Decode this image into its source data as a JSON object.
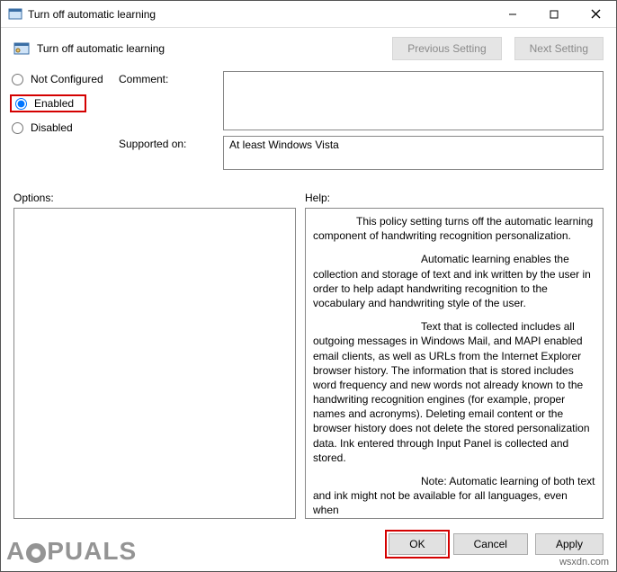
{
  "window": {
    "title": "Turn off automatic learning"
  },
  "header": {
    "name": "Turn off automatic learning",
    "prev": "Previous Setting",
    "next": "Next Setting"
  },
  "state": {
    "not_configured": "Not Configured",
    "enabled": "Enabled",
    "disabled": "Disabled",
    "selected": "enabled"
  },
  "labels": {
    "comment": "Comment:",
    "supported": "Supported on:",
    "options": "Options:",
    "help": "Help:"
  },
  "fields": {
    "comment_value": "",
    "supported_value": "At least Windows Vista"
  },
  "help": {
    "p1": "This policy setting turns off the automatic learning component of handwriting recognition personalization.",
    "p2": "Automatic learning enables the collection and storage of text and ink written by the user in order to help adapt handwriting recognition to the vocabulary and handwriting style of the user.",
    "p3": "Text that is collected includes all outgoing messages in Windows Mail, and MAPI enabled email clients, as well as URLs from the Internet Explorer browser history. The information that is stored includes word frequency and new words not already known to the handwriting recognition engines (for example, proper names and acronyms). Deleting email content or the browser history does not delete the stored personalization data. Ink entered through Input Panel is collected and stored.",
    "p4": "Note: Automatic learning of both text and ink might not be available for all languages, even when"
  },
  "buttons": {
    "ok": "OK",
    "cancel": "Cancel",
    "apply": "Apply"
  },
  "watermark": {
    "pre": "A",
    "post": "PUALS",
    "credit": "wsxdn.com"
  }
}
